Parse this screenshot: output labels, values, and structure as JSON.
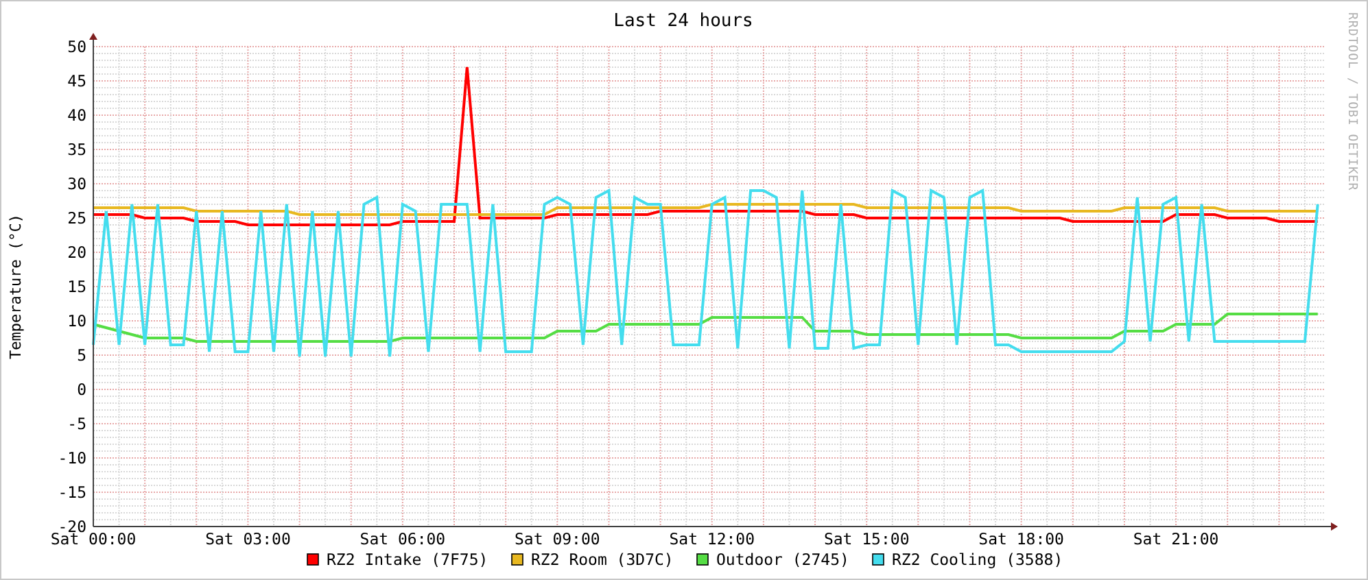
{
  "credit": "RRDTOOL / TOBI OETIKER",
  "chart_data": {
    "type": "line",
    "title": "Last 24 hours",
    "ylabel": "Temperature (°C)",
    "categories": [
      "Sat 00:00",
      null,
      null,
      null,
      null,
      null,
      null,
      null,
      null,
      null,
      null,
      null,
      "Sat 03:00",
      null,
      null,
      null,
      null,
      null,
      null,
      null,
      null,
      null,
      null,
      null,
      "Sat 06:00",
      null,
      null,
      null,
      null,
      null,
      null,
      null,
      null,
      null,
      null,
      null,
      "Sat 09:00",
      null,
      null,
      null,
      null,
      null,
      null,
      null,
      null,
      null,
      null,
      null,
      "Sat 12:00",
      null,
      null,
      null,
      null,
      null,
      null,
      null,
      null,
      null,
      null,
      null,
      "Sat 15:00",
      null,
      null,
      null,
      null,
      null,
      null,
      null,
      null,
      null,
      null,
      null,
      "Sat 18:00",
      null,
      null,
      null,
      null,
      null,
      null,
      null,
      null,
      null,
      null,
      null,
      "Sat 21:00",
      null,
      null,
      null,
      null,
      null,
      null,
      null,
      null,
      null,
      null,
      null
    ],
    "ylim": [
      -20,
      50
    ],
    "grid": true,
    "legend": "bottom",
    "yticks": [
      -20,
      -15,
      -10,
      -5,
      0,
      5,
      10,
      15,
      20,
      25,
      30,
      35,
      40,
      45,
      50
    ],
    "series": [
      {
        "name": "RZ2 Intake (7F75)",
        "color": "#ff0000",
        "values": [
          25.5,
          25.5,
          25.5,
          25.5,
          25,
          25,
          25,
          25,
          24.5,
          24.5,
          24.5,
          24.5,
          24,
          24,
          24,
          24,
          24,
          24,
          24,
          24,
          24,
          24,
          24,
          24,
          24.5,
          24.5,
          24.5,
          24.5,
          24.5,
          47,
          25,
          25,
          25,
          25,
          25,
          25,
          25.5,
          25.5,
          25.5,
          25.5,
          25.5,
          25.5,
          25.5,
          25.5,
          26,
          26,
          26,
          26,
          26,
          26,
          26,
          26,
          26,
          26,
          26,
          26,
          25.5,
          25.5,
          25.5,
          25.5,
          25,
          25,
          25,
          25,
          25,
          25,
          25,
          25,
          25,
          25,
          25,
          25,
          25,
          25,
          25,
          25,
          24.5,
          24.5,
          24.5,
          24.5,
          24.5,
          24.5,
          24.5,
          24.5,
          25.5,
          25.5,
          25.5,
          25.5,
          25,
          25,
          25,
          25,
          24.5,
          24.5,
          24.5,
          24.5
        ]
      },
      {
        "name": "RZ2 Room (3D7C)",
        "color": "#e8b820",
        "values": [
          26.5,
          26.5,
          26.5,
          26.5,
          26.5,
          26.5,
          26.5,
          26.5,
          26,
          26,
          26,
          26,
          26,
          26,
          26,
          26,
          25.5,
          25.5,
          25.5,
          25.5,
          25.5,
          25.5,
          25.5,
          25.5,
          25.5,
          25.5,
          25.5,
          25.5,
          25.5,
          25.5,
          25.5,
          25.5,
          25.5,
          25.5,
          25.5,
          25.5,
          26.5,
          26.5,
          26.5,
          26.5,
          26.5,
          26.5,
          26.5,
          26.5,
          26.5,
          26.5,
          26.5,
          26.5,
          27,
          27,
          27,
          27,
          27,
          27,
          27,
          27,
          27,
          27,
          27,
          27,
          26.5,
          26.5,
          26.5,
          26.5,
          26.5,
          26.5,
          26.5,
          26.5,
          26.5,
          26.5,
          26.5,
          26.5,
          26,
          26,
          26,
          26,
          26,
          26,
          26,
          26,
          26.5,
          26.5,
          26.5,
          26.5,
          26.5,
          26.5,
          26.5,
          26.5,
          26,
          26,
          26,
          26,
          26,
          26,
          26,
          26
        ]
      },
      {
        "name": "Outdoor (2745)",
        "color": "#55dd44",
        "values": [
          9.5,
          9,
          8.5,
          8,
          7.5,
          7.5,
          7.5,
          7.5,
          7,
          7,
          7,
          7,
          7,
          7,
          7,
          7,
          7,
          7,
          7,
          7,
          7,
          7,
          7,
          7,
          7.5,
          7.5,
          7.5,
          7.5,
          7.5,
          7.5,
          7.5,
          7.5,
          7.5,
          7.5,
          7.5,
          7.5,
          8.5,
          8.5,
          8.5,
          8.5,
          9.5,
          9.5,
          9.5,
          9.5,
          9.5,
          9.5,
          9.5,
          9.5,
          10.5,
          10.5,
          10.5,
          10.5,
          10.5,
          10.5,
          10.5,
          10.5,
          8.5,
          8.5,
          8.5,
          8.5,
          8,
          8,
          8,
          8,
          8,
          8,
          8,
          8,
          8,
          8,
          8,
          8,
          7.5,
          7.5,
          7.5,
          7.5,
          7.5,
          7.5,
          7.5,
          7.5,
          8.5,
          8.5,
          8.5,
          8.5,
          9.5,
          9.5,
          9.5,
          9.5,
          11,
          11,
          11,
          11,
          11,
          11,
          11,
          11
        ]
      },
      {
        "name": "RZ2 Cooling (3588)",
        "color": "#44ddee",
        "values": [
          6.5,
          26,
          6.5,
          27,
          6.5,
          27,
          6.5,
          6.5,
          26,
          5.5,
          26,
          5.5,
          5.5,
          26,
          5.5,
          27,
          4.8,
          26,
          4.8,
          26,
          4.8,
          27,
          28,
          4.8,
          27,
          26,
          5.5,
          27,
          27,
          27,
          5.5,
          27,
          5.5,
          5.5,
          5.5,
          27,
          28,
          27,
          6.5,
          28,
          29,
          6.5,
          28,
          27,
          27,
          6.5,
          6.5,
          6.5,
          27,
          28,
          6,
          29,
          29,
          28,
          6,
          29,
          6,
          6,
          27,
          6,
          6.5,
          6.5,
          29,
          28,
          6.5,
          29,
          28,
          6.5,
          28,
          29,
          6.5,
          6.5,
          5.5,
          5.5,
          5.5,
          5.5,
          5.5,
          5.5,
          5.5,
          5.5,
          7,
          28,
          7,
          27,
          28,
          7,
          27,
          7,
          7,
          7,
          7,
          7,
          7,
          7,
          7,
          27
        ]
      }
    ]
  }
}
